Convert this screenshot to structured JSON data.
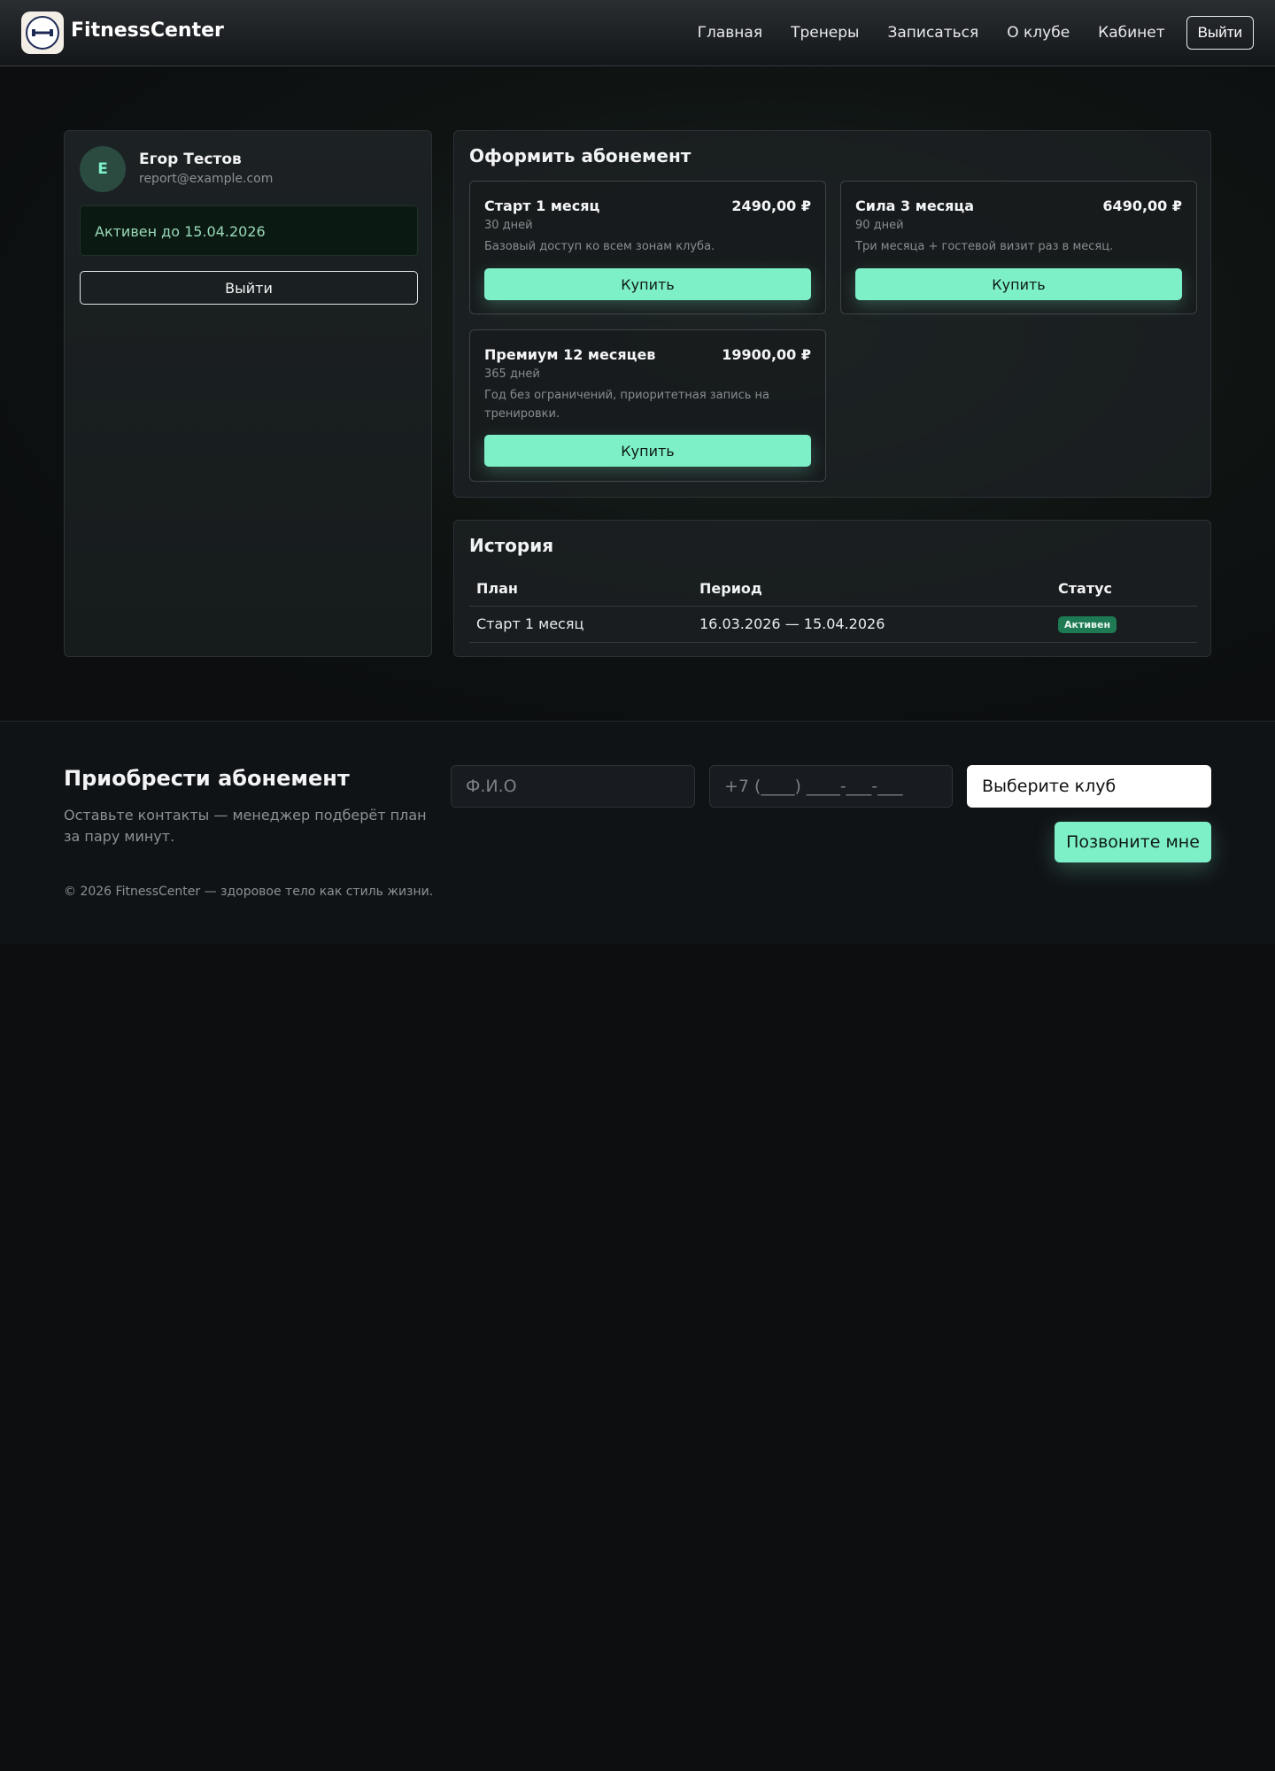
{
  "header": {
    "brand": "FitnessCenter",
    "nav": [
      "Главная",
      "Тренеры",
      "Записаться",
      "О клубе",
      "Кабинет"
    ],
    "logout_label": "Выйти"
  },
  "profile": {
    "avatar_letter": "E",
    "name": "Егор Тестов",
    "email": "report@example.com",
    "status": "Активен до 15.04.2026",
    "logout_label": "Выйти"
  },
  "subscribe": {
    "title": "Оформить абонемент",
    "plans": [
      {
        "name": "Старт 1 месяц",
        "price": "2490,00 ₽",
        "days": "30 дней",
        "desc": "Базовый доступ ко всем зонам клуба.",
        "button": "Купить"
      },
      {
        "name": "Сила 3 месяца",
        "price": "6490,00 ₽",
        "days": "90 дней",
        "desc": "Три месяца + гостевой визит раз в месяц.",
        "button": "Купить"
      },
      {
        "name": "Премиум 12 месяцев",
        "price": "19900,00 ₽",
        "days": "365 дней",
        "desc": "Год без ограничений, приоритетная запись на тренировки.",
        "button": "Купить"
      }
    ]
  },
  "history": {
    "title": "История",
    "columns": [
      "План",
      "Период",
      "Статус"
    ],
    "rows": [
      {
        "plan": "Старт 1 месяц",
        "period": "16.03.2026 — 15.04.2026",
        "status": "Активен"
      }
    ]
  },
  "footer": {
    "title": "Приобрести абонемент",
    "subtitle": "Оставьте контакты — менеджер подберёт план за пару минут.",
    "name_placeholder": "Ф.И.О",
    "phone_placeholder": "+7 (____) ____-___-___",
    "club_select": "Выберите клуб",
    "call_button": "Позвоните мне",
    "copyright": "© 2026 FitnessCenter — здоровое тело как стиль жизни."
  },
  "colors": {
    "accent": "#7ef0c8",
    "background": "#0c0e10",
    "badge_active": "#1d7a52"
  }
}
